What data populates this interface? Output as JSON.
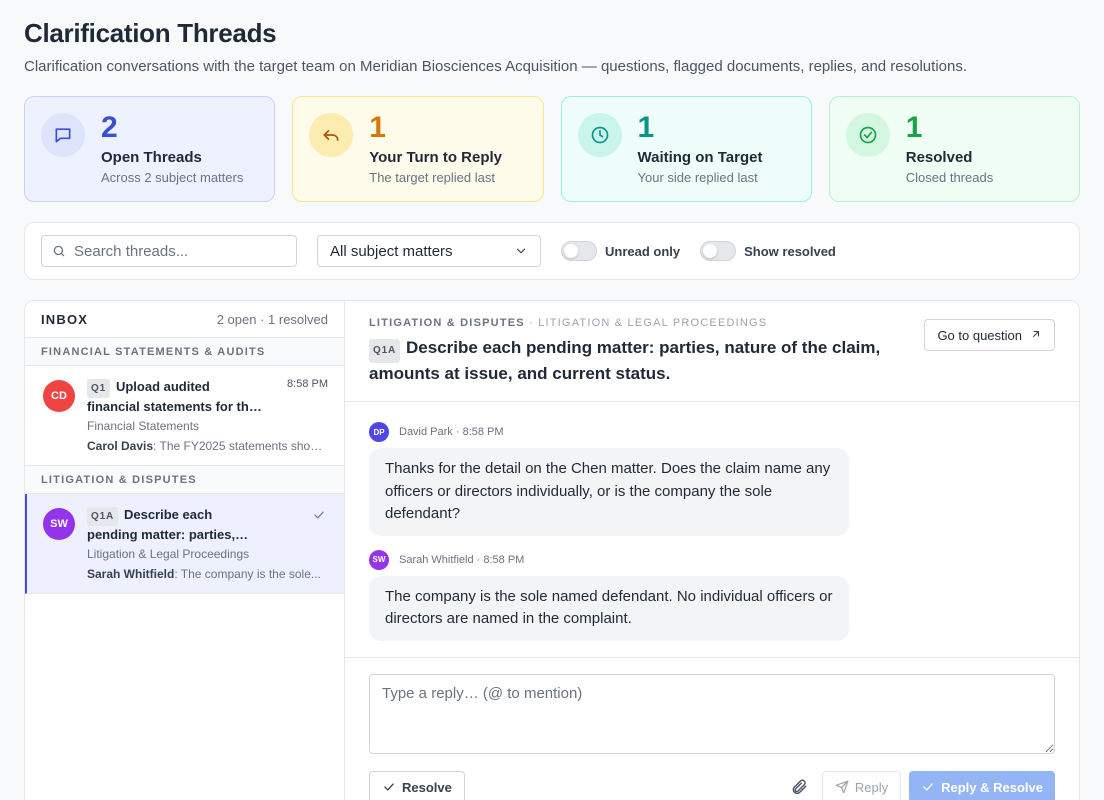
{
  "header": {
    "title": "Clarification Threads",
    "subtitle": "Clarification conversations with the target team on Meridian Biosciences Acquisition — questions, flagged documents, replies, and resolutions."
  },
  "stats": [
    {
      "value": "2",
      "label": "Open Threads",
      "sub": "Across 2 subject matters",
      "icon": "chat-bubble-icon",
      "accent": "#3b4fd6"
    },
    {
      "value": "1",
      "label": "Your Turn to Reply",
      "sub": "The target replied last",
      "icon": "reply-arrow-icon",
      "accent": "#d97706"
    },
    {
      "value": "1",
      "label": "Waiting on Target",
      "sub": "Your side replied last",
      "icon": "clock-icon",
      "accent": "#0d9488"
    },
    {
      "value": "1",
      "label": "Resolved",
      "sub": "Closed threads",
      "icon": "check-circle-icon",
      "accent": "#16a34a"
    }
  ],
  "filters": {
    "search_placeholder": "Search threads...",
    "subject_select": "All subject matters",
    "unread_label": "Unread only",
    "resolved_label": "Show resolved"
  },
  "inbox": {
    "title": "INBOX",
    "count": "2 open · 1 resolved",
    "groups": [
      {
        "name": "FINANCIAL STATEMENTS & AUDITS",
        "items": [
          {
            "initials": "CD",
            "avatar_color": "#ef4444",
            "qtag": "Q1",
            "question": "Upload audited financial statements for the last t...",
            "time": "8:58 PM",
            "category": "Financial Statements",
            "author": "Carol Davis",
            "snippet": ": The FY2025 statements show..."
          }
        ]
      },
      {
        "name": "LITIGATION & DISPUTES",
        "items": [
          {
            "initials": "SW",
            "avatar_color": "#9333ea",
            "qtag": "Q1A",
            "question": "Describe each pending matter: parties, nature of t...",
            "time": "",
            "category": "Litigation & Legal Proceedings",
            "author": "Sarah Whitfield",
            "snippet": ": The company is the sole..."
          }
        ]
      }
    ]
  },
  "thread": {
    "crumb_main": "LITIGATION & DISPUTES",
    "crumb_sep": "·",
    "crumb_sub": "LITIGATION & LEGAL PROCEEDINGS",
    "qtag": "Q1A",
    "title": "Describe each pending matter: parties, nature of the claim, amounts at issue, and current status.",
    "go_label": "Go to question",
    "messages": [
      {
        "initials": "DP",
        "avatar_color": "#4f46e5",
        "meta": "David Park · 8:58 PM",
        "text": "Thanks for the detail on the Chen matter. Does the claim name any officers or directors individually, or is the company the sole defendant?"
      },
      {
        "initials": "SW",
        "avatar_color": "#9333ea",
        "meta": "Sarah Whitfield · 8:58 PM",
        "text": "The company is the sole named defendant. No individual officers or directors are named in the complaint."
      }
    ],
    "composer_placeholder": "Type a reply… (@ to mention)",
    "resolve_label": "Resolve",
    "reply_label": "Reply",
    "reply_resolve_label": "Reply & Resolve"
  }
}
